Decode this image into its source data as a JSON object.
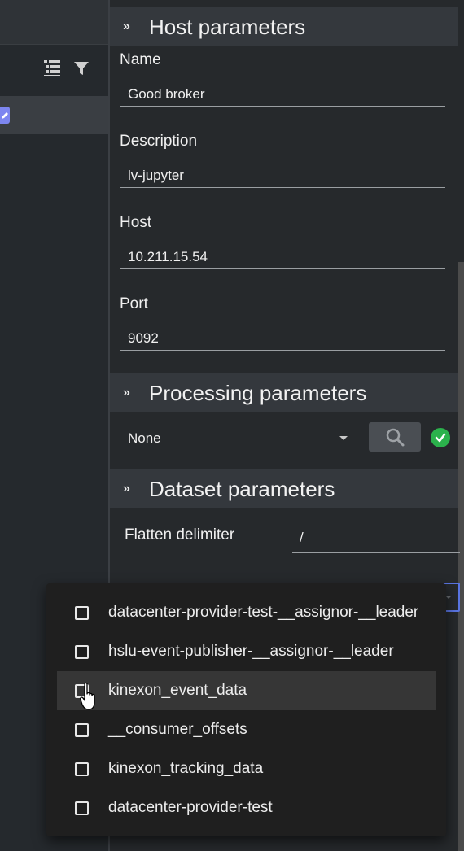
{
  "host_section": {
    "title": "Host parameters",
    "fields": {
      "name": {
        "label": "Name",
        "value": "Good broker"
      },
      "description": {
        "label": "Description",
        "value": "lv-jupyter"
      },
      "host": {
        "label": "Host",
        "value": "10.211.15.54"
      },
      "port": {
        "label": "Port",
        "value": "9092"
      }
    }
  },
  "processing_section": {
    "title": "Processing parameters",
    "selected": "None",
    "status": "valid"
  },
  "dataset_section": {
    "title": "Dataset parameters",
    "flatten_delimiter": {
      "label": "Flatten delimiter",
      "value": "/"
    }
  },
  "topic_dropdown": {
    "options": [
      {
        "label": "datacenter-provider-test-__assignor-__leader",
        "checked": false
      },
      {
        "label": "hslu-event-publisher-__assignor-__leader",
        "checked": false
      },
      {
        "label": "kinexon_event_data",
        "checked": false,
        "hovered": true
      },
      {
        "label": "__consumer_offsets",
        "checked": false
      },
      {
        "label": "kinexon_tracking_data",
        "checked": false
      },
      {
        "label": "datacenter-provider-test",
        "checked": false
      }
    ]
  },
  "colors": {
    "accent": "#5a75e3",
    "success": "#2bb24c",
    "edit_chip": "#7d86f0"
  }
}
